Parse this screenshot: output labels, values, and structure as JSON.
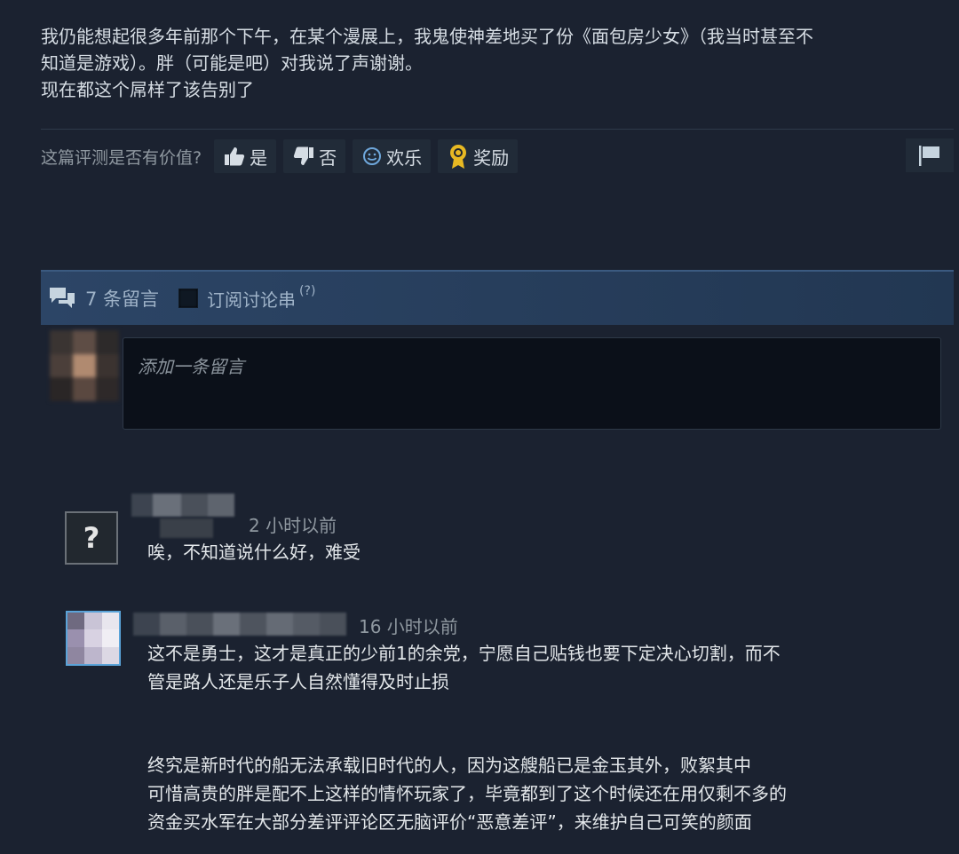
{
  "review": {
    "lines": [
      "我仍能想起很多年前那个下午，在某个漫展上，我鬼使神差地买了份《面包房少女》（我当时甚至不",
      "知道是游戏）。胖（可能是吧）对我说了声谢谢。",
      "现在都这个屌样了该告别了"
    ]
  },
  "vote": {
    "question": "这篇评测是否有价值?",
    "yes": "是",
    "no": "否",
    "funny": "欢乐",
    "award": "奖励"
  },
  "comments_header": {
    "count_label": "7 条留言",
    "subscribe_label": "订阅讨论串",
    "help": "(?)"
  },
  "comment_input": {
    "placeholder": "添加一条留言"
  },
  "comments": [
    {
      "time": "2 小时以前",
      "lines": [
        "唉，不知道说什么好，难受"
      ]
    },
    {
      "time": "16 小时以前",
      "lines": [
        "这不是勇士，这才是真正的少前1的余党，宁愿自己贴钱也要下定决心切割，而不",
        "管是路人还是乐子人自然懂得及时止损",
        "终究是新时代的船无法承载旧时代的人，因为这艘船已是金玉其外，败絮其中",
        "可惜高贵的胖是配不上这样的情怀玩家了，毕竟都到了这个时候还在用仅剩不多的",
        "资金买水军在大部分差评评论区无脑评价“恶意差评”，来维护自己可笑的颜面"
      ]
    }
  ],
  "colors": {
    "background": "#1b2230",
    "header_bar": "#2c4566",
    "award_gold": "#e8b923"
  }
}
